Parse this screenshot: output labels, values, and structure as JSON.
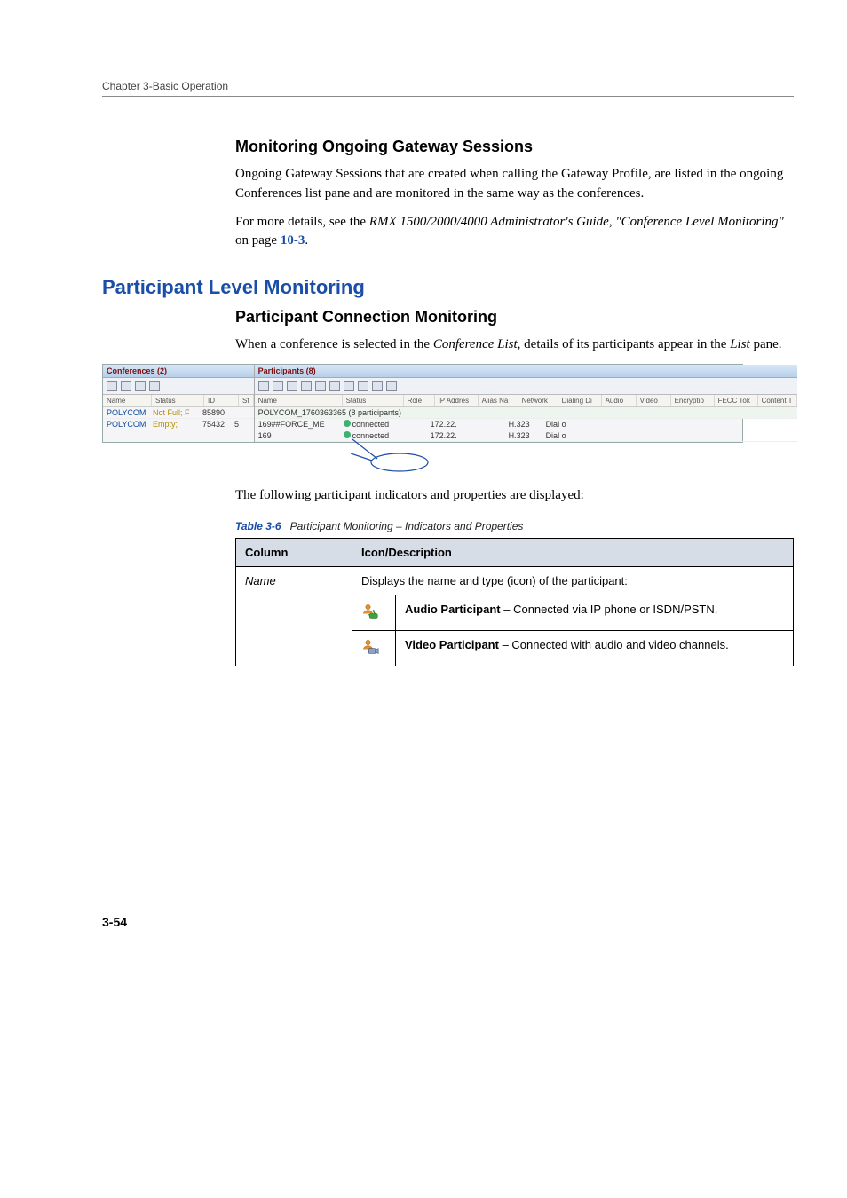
{
  "running_header": "Chapter 3-Basic Operation",
  "page_number": "3-54",
  "sec1": {
    "heading": "Monitoring Ongoing Gateway Sessions",
    "p1": "Ongoing Gateway Sessions that are created when calling the Gateway Profile, are listed in the ongoing Conferences list pane and are monitored in the same way as the conferences.",
    "p2_a": "For more details, see the ",
    "p2_em": "RMX 1500/2000/4000 Administrator's Guide",
    "p2_b": ", ",
    "p2_em2": "\"Conference Level Monitoring\"",
    "p2_c": " on page ",
    "p2_link": "10-3",
    "p2_d": "."
  },
  "main_heading": "Participant Level Monitoring",
  "sec2": {
    "heading": "Participant Connection Monitoring",
    "p1_a": "When a conference is selected in the ",
    "p1_em": "Conference List",
    "p1_b": ", details of its participants appear in the ",
    "p1_em2": "List",
    "p1_c": " pane."
  },
  "app": {
    "conf_header": "Conferences (2)",
    "part_header": "Participants (8)",
    "conf_cols": [
      "Name",
      "Status",
      "ID",
      "St"
    ],
    "part_cols": [
      "Name",
      "Status",
      "Role",
      "IP Addres",
      "Alias Na",
      "Network",
      "Dialing Di",
      "Audio",
      "Video",
      "Encryptio",
      "FECC Tok",
      "Content T"
    ],
    "conf_rows": [
      {
        "name": "POLYCOM",
        "status": "Not Full; F",
        "id": "85890"
      },
      {
        "name": "POLYCOM",
        "status": "Empty;",
        "id": "75432",
        "st": "5"
      }
    ],
    "group_row": "POLYCOM_1760363365 (8 participants)",
    "part_rows": [
      {
        "name": "169##FORCE_ME",
        "status": "connected",
        "ip": "172.22.",
        "net": "H.323",
        "dial": "Dial o"
      },
      {
        "name": "169",
        "status": "connected",
        "ip": "172.22.",
        "net": "H.323",
        "dial": "Dial o"
      }
    ]
  },
  "after_shot": "The following participant indicators and properties are displayed:",
  "table": {
    "label": "Table 3-6",
    "caption": "Participant Monitoring – Indicators and Properties",
    "head_col": "Column",
    "head_desc": "Icon/Description",
    "name_label": "Name",
    "name_row_desc": "Displays the name and type (icon) of the participant:",
    "audio_label": "Audio Participant",
    "audio_desc": " – Connected via IP phone or ISDN/PSTN.",
    "video_label": "Video Participant",
    "video_desc": " – Connected with audio and video channels."
  }
}
